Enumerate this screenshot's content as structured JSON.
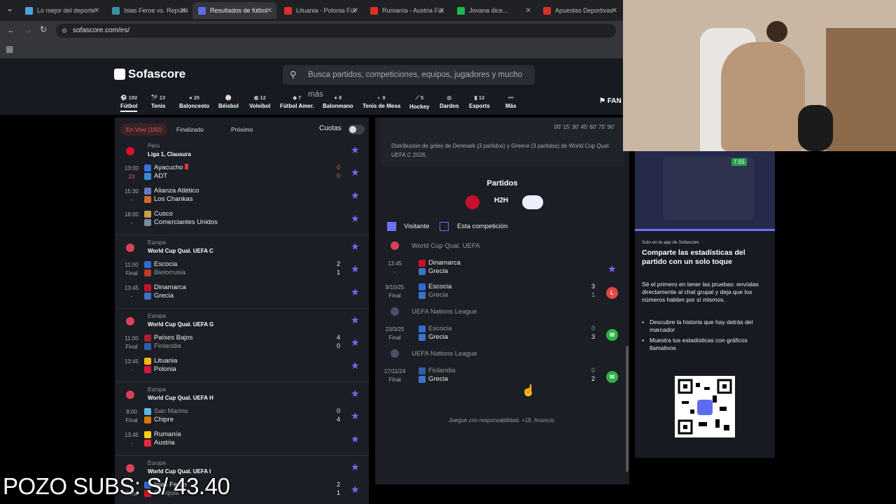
{
  "browser": {
    "tabs": [
      {
        "label": "Lo mejor del deporte",
        "color": "#4aa3df",
        "active": false
      },
      {
        "label": "Islas Feroe vs. Repúbli",
        "color": "#3b8ea5",
        "active": false
      },
      {
        "label": "Resultados de fútbol",
        "color": "#5b6cf0",
        "active": true
      },
      {
        "label": "Lituania - Polonia Fút",
        "color": "#d93025",
        "active": false
      },
      {
        "label": "Rumanía - Austria Fút",
        "color": "#d93025",
        "active": false
      },
      {
        "label": "Jovana dice...",
        "color": "#1db954",
        "active": false
      },
      {
        "label": "Apuestas Deportivas",
        "color": "#d93025",
        "active": false
      }
    ],
    "url": "sofascore.com/es/"
  },
  "header": {
    "logo": "Sofascore",
    "search_placeholder": "Busca partidos, competiciones, equipos, jugadores y mucho más",
    "fan_label": "FAN",
    "sports": [
      {
        "count": "192",
        "label": "Fútbol",
        "icon": "soccer-icon",
        "active": true
      },
      {
        "count": "13",
        "label": "Tenis",
        "icon": "tennis-icon"
      },
      {
        "count": "25",
        "label": "Baloncesto",
        "icon": "basketball-icon"
      },
      {
        "count": "",
        "label": "Béisbol",
        "icon": "baseball-icon"
      },
      {
        "count": "12",
        "label": "Voleibol",
        "icon": "volleyball-icon"
      },
      {
        "count": "7",
        "label": "Fútbol Amer.",
        "icon": "football-icon"
      },
      {
        "count": "8",
        "label": "Balonmano",
        "icon": "handball-icon"
      },
      {
        "count": "9",
        "label": "Tenis de Mesa",
        "icon": "table-tennis-icon"
      },
      {
        "count": "5",
        "label": "Hockey",
        "icon": "hockey-icon"
      },
      {
        "count": "",
        "label": "Dardos",
        "icon": "darts-icon"
      },
      {
        "count": "12",
        "label": "Esports",
        "icon": "esports-icon"
      },
      {
        "count": "•••",
        "label": "Más",
        "icon": "more-icon"
      }
    ]
  },
  "left": {
    "filters": {
      "live": "En Vivo (192)",
      "finished": "Finalizado",
      "upcoming": "Próximo",
      "odds": "Cuotas"
    },
    "leagues": [
      {
        "country": "Perú",
        "name": "Liga 1, Clausura",
        "flag": "#d91023",
        "matches": [
          {
            "time": "13:00",
            "status": "23",
            "home": "Ayacucho",
            "away": "ADT",
            "hs": "0",
            "as": "0",
            "live": true,
            "homeDim": false,
            "awayDim": false,
            "hc": "#3b6fd9",
            "ac": "#3a8bd6"
          },
          {
            "time": "15:30",
            "status": "-",
            "home": "Alianza Atlético",
            "away": "Los Chankas",
            "hs": "",
            "as": "",
            "homeDim": false,
            "awayDim": false,
            "hc": "#6b76c6",
            "ac": "#d06a2b"
          },
          {
            "time": "18:00",
            "status": "-",
            "home": "Cusco",
            "away": "Comerciantes Unidos",
            "hs": "",
            "as": "",
            "homeDim": false,
            "awayDim": false,
            "hc": "#c7a04a",
            "ac": "#7a8aa0"
          }
        ]
      },
      {
        "country": "Europa",
        "name": "World Cup Qual. UEFA C",
        "flag": "#d9405a",
        "matches": [
          {
            "time": "11:00",
            "status": "Final",
            "home": "Escocia",
            "away": "Bielorrusia",
            "hs": "2",
            "as": "1",
            "homeDim": false,
            "awayDim": true,
            "hc": "#2f6bd1",
            "ac": "#c0392b"
          },
          {
            "time": "13:45",
            "status": "-",
            "home": "Dinamarca",
            "away": "Grecia",
            "hs": "",
            "as": "",
            "homeDim": false,
            "awayDim": false,
            "hc": "#c8102e",
            "ac": "#3a73c9"
          }
        ]
      },
      {
        "country": "Europa",
        "name": "World Cup Qual. UEFA G",
        "flag": "#d9405a",
        "matches": [
          {
            "time": "11:00",
            "status": "Final",
            "home": "Países Bajos",
            "away": "Finlandia",
            "hs": "4",
            "as": "0",
            "homeDim": false,
            "awayDim": true,
            "hc": "#ae1c28",
            "ac": "#2c5fa8"
          },
          {
            "time": "13:45",
            "status": "-",
            "home": "Lituania",
            "away": "Polonia",
            "hs": "",
            "as": "",
            "homeDim": false,
            "awayDim": false,
            "hc": "#fdb913",
            "ac": "#dc143c"
          }
        ]
      },
      {
        "country": "Europa",
        "name": "World Cup Qual. UEFA H",
        "flag": "#d9405a",
        "matches": [
          {
            "time": "8:00",
            "status": "Final",
            "home": "San Marino",
            "away": "Chipre",
            "hs": "0",
            "as": "4",
            "homeDim": true,
            "awayDim": false,
            "hc": "#5eb6e4",
            "ac": "#d57800"
          },
          {
            "time": "13:45",
            "status": "-",
            "home": "Rumanía",
            "away": "Austria",
            "hs": "",
            "as": "",
            "homeDim": false,
            "awayDim": false,
            "hc": "#fcd116",
            "ac": "#ed2939"
          }
        ]
      },
      {
        "country": "Europa",
        "name": "World Cup Qual. UEFA I",
        "flag": "#d9405a",
        "matches": [
          {
            "time": "",
            "status": "Final",
            "home": "Islas Feroe",
            "away": "Chequia",
            "hs": "2",
            "as": "1",
            "homeDim": false,
            "awayDim": true,
            "hc": "#2f6bd1",
            "ac": "#d7141a"
          }
        ]
      }
    ]
  },
  "center": {
    "minutes": "00' 15' 30' 45' 60' 75' 90'",
    "goal_note": "Distribución de goles de Denmark (3 partidos) y Greece (3 partidos) de World Cup Qual. UEFA C 2026.",
    "title": "Partidos",
    "h2h": "H2H",
    "check_visitor": "Visitante",
    "check_comp": "Esta competición",
    "sections": [
      {
        "comp": "World Cup Qual. UEFA",
        "games": [
          {
            "date": "13:45",
            "status": "-",
            "home": "Dinamarca",
            "away": "Grecia",
            "hs": "",
            "as": "",
            "homeDim": false,
            "awayDim": false,
            "result": "",
            "star": true,
            "hc": "#c8102e",
            "ac": "#3a73c9"
          },
          {
            "date": "9/10/25",
            "status": "Final",
            "home": "Escocia",
            "away": "Grecia",
            "hs": "3",
            "as": "1",
            "homeDim": false,
            "awayDim": true,
            "result": "L",
            "star": false,
            "hc": "#2f6bd1",
            "ac": "#3a73c9"
          }
        ]
      },
      {
        "comp": "UEFA Nations League",
        "games": [
          {
            "date": "23/3/25",
            "status": "Final",
            "home": "Escocia",
            "away": "Grecia",
            "hs": "0",
            "as": "3",
            "homeDim": true,
            "awayDim": false,
            "result": "W",
            "star": false,
            "hc": "#2f6bd1",
            "ac": "#3a73c9"
          }
        ]
      },
      {
        "comp": "UEFA Nations League",
        "games": [
          {
            "date": "17/11/24",
            "status": "Final",
            "home": "Finlandia",
            "away": "Grecia",
            "hs": "0",
            "as": "2",
            "homeDim": true,
            "awayDim": false,
            "result": "W",
            "star": false,
            "hc": "#2c5fa8",
            "ac": "#3a73c9"
          }
        ]
      }
    ],
    "footer": "Juegue con responsabilidad. +18. Anuncio."
  },
  "promo": {
    "tag": "Solo en la app de Sofascore",
    "title": "Comparte las estadísticas del partido con un solo toque",
    "text": "Sé el primero en tener las pruebas: envíalas directamente al chat grupal y deja que los números hablen por sí mismos.",
    "bullets": [
      "Descubre la historia que hay detrás del marcador",
      "Muestra tus estadísticas con gráficos llamativos"
    ],
    "rating": "7.55"
  },
  "overlay": {
    "subs": "POZO SUBS: S/ 43.40"
  },
  "colors": {
    "accent": "#6b72f5",
    "win": "#2fb344",
    "loss": "#e04545",
    "live": "#e35d5d"
  }
}
